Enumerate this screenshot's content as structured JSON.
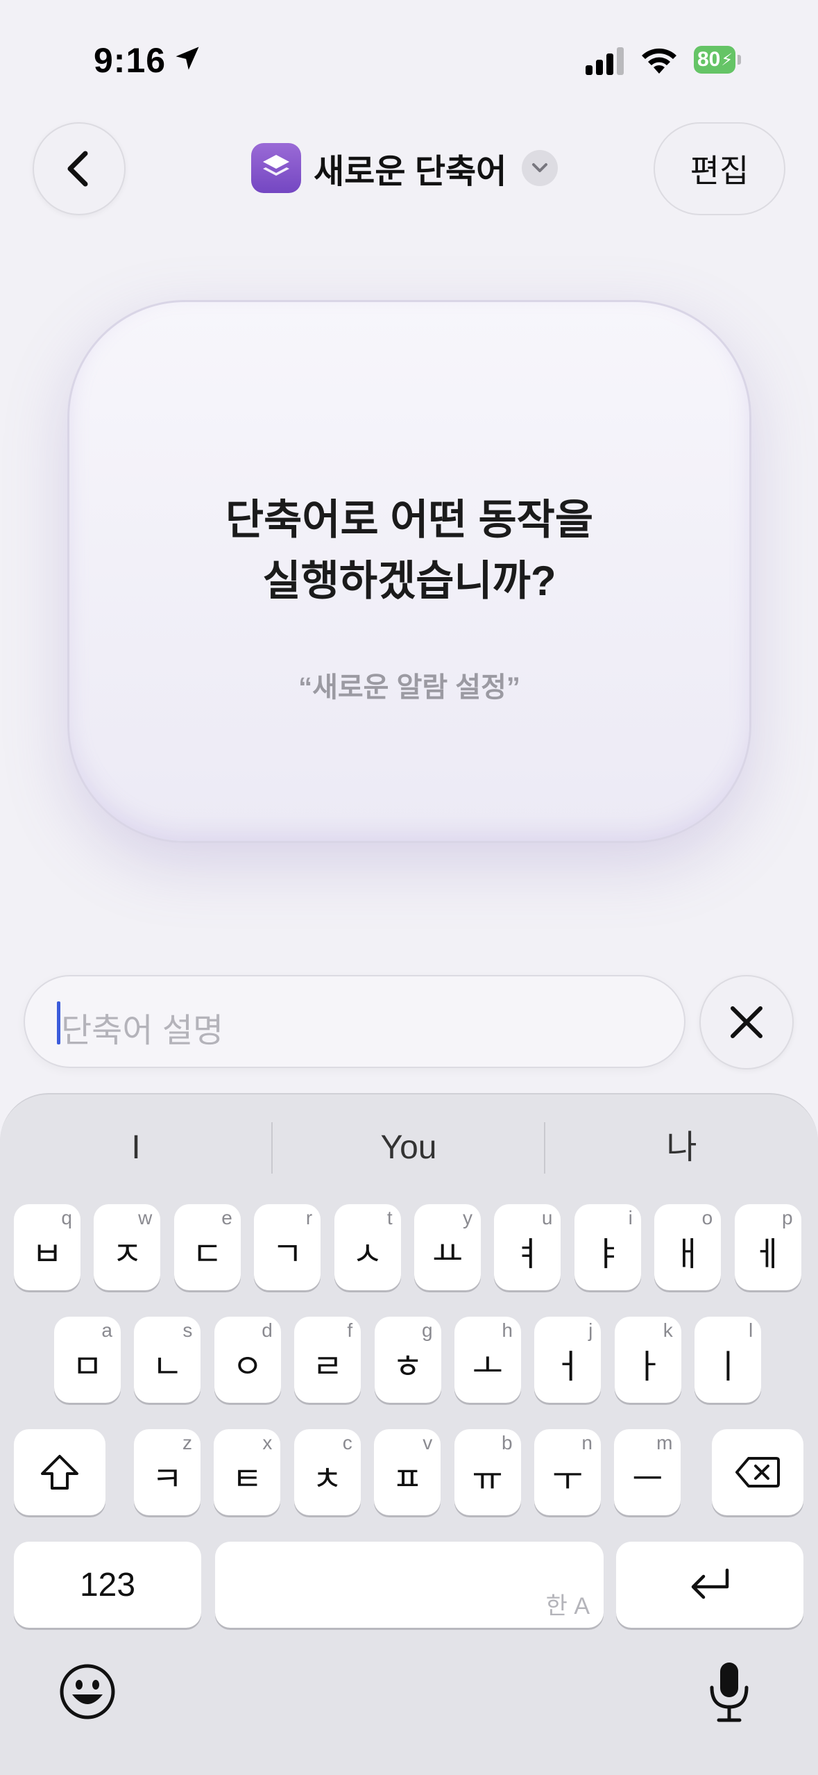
{
  "status_bar": {
    "time": "9:16",
    "battery": "80"
  },
  "header": {
    "title": "새로운 단축어",
    "edit_label": "편집"
  },
  "card": {
    "question": "단축어로 어떤 동작을\n실행하겠습니까?",
    "example": "“새로운 알람 설정”"
  },
  "description_field": {
    "placeholder": "단축어 설명"
  },
  "keyboard": {
    "suggestions": [
      "I",
      "You",
      "나"
    ],
    "row1": [
      {
        "key": "ㅂ",
        "hint": "q"
      },
      {
        "key": "ㅈ",
        "hint": "w"
      },
      {
        "key": "ㄷ",
        "hint": "e"
      },
      {
        "key": "ㄱ",
        "hint": "r"
      },
      {
        "key": "ㅅ",
        "hint": "t"
      },
      {
        "key": "ㅛ",
        "hint": "y"
      },
      {
        "key": "ㅕ",
        "hint": "u"
      },
      {
        "key": "ㅑ",
        "hint": "i"
      },
      {
        "key": "ㅐ",
        "hint": "o"
      },
      {
        "key": "ㅔ",
        "hint": "p"
      }
    ],
    "row2": [
      {
        "key": "ㅁ",
        "hint": "a"
      },
      {
        "key": "ㄴ",
        "hint": "s"
      },
      {
        "key": "ㅇ",
        "hint": "d"
      },
      {
        "key": "ㄹ",
        "hint": "f"
      },
      {
        "key": "ㅎ",
        "hint": "g"
      },
      {
        "key": "ㅗ",
        "hint": "h"
      },
      {
        "key": "ㅓ",
        "hint": "j"
      },
      {
        "key": "ㅏ",
        "hint": "k"
      },
      {
        "key": "ㅣ",
        "hint": "l"
      }
    ],
    "row3": [
      {
        "key": "ㅋ",
        "hint": "z"
      },
      {
        "key": "ㅌ",
        "hint": "x"
      },
      {
        "key": "ㅊ",
        "hint": "c"
      },
      {
        "key": "ㅍ",
        "hint": "v"
      },
      {
        "key": "ㅠ",
        "hint": "b"
      },
      {
        "key": "ㅜ",
        "hint": "n"
      },
      {
        "key": "ㅡ",
        "hint": "m"
      }
    ],
    "numbers_label": "123",
    "space_hint": "한 A"
  },
  "icons": {
    "location": "location-arrow-icon",
    "back": "chevron-left-icon",
    "app": "shortcuts-app-icon",
    "dropdown": "chevron-down-icon",
    "clear": "close-icon",
    "shift": "shift-icon",
    "delete": "backspace-icon",
    "return": "return-icon",
    "emoji": "emoji-icon",
    "mic": "microphone-icon"
  },
  "colors": {
    "accent": "#7447c2",
    "battery": "#65c466",
    "caret": "#3b5bdb"
  }
}
